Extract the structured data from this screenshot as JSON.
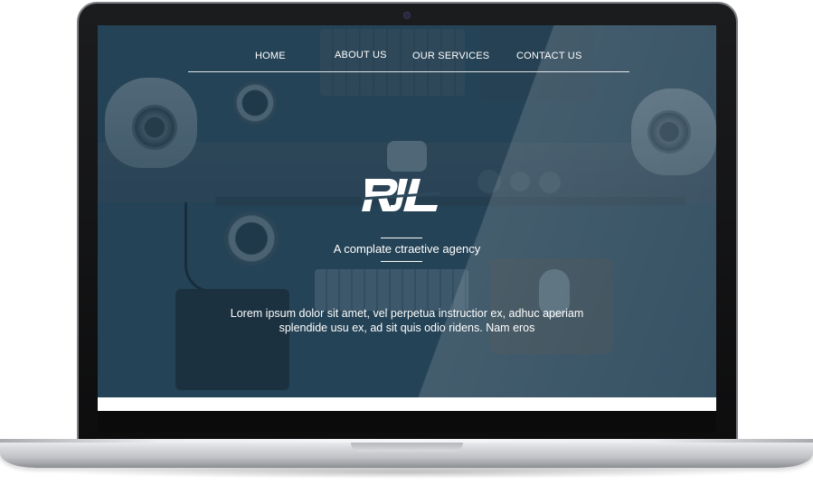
{
  "nav": {
    "items": [
      {
        "label": "HOME"
      },
      {
        "label": "ABOUT US"
      },
      {
        "label": "OUR SERVICES"
      },
      {
        "label": "CONTACT US"
      }
    ]
  },
  "hero": {
    "logo_text": "RJL",
    "tagline": "A complate ctraetive agency",
    "description": "Lorem ipsum dolor sit amet, vel perpetua instructior ex, adhuc aperiam splendide usu ex, ad sit quis odio ridens. Nam eros"
  },
  "colors": {
    "overlay": "#2c4a5c",
    "text": "#ffffff",
    "laptop_bezel": "#0d0d0e",
    "laptop_body": "#c9cbcf"
  },
  "icons": {
    "camera": "camera-icon",
    "logo": "rjl-logo"
  }
}
